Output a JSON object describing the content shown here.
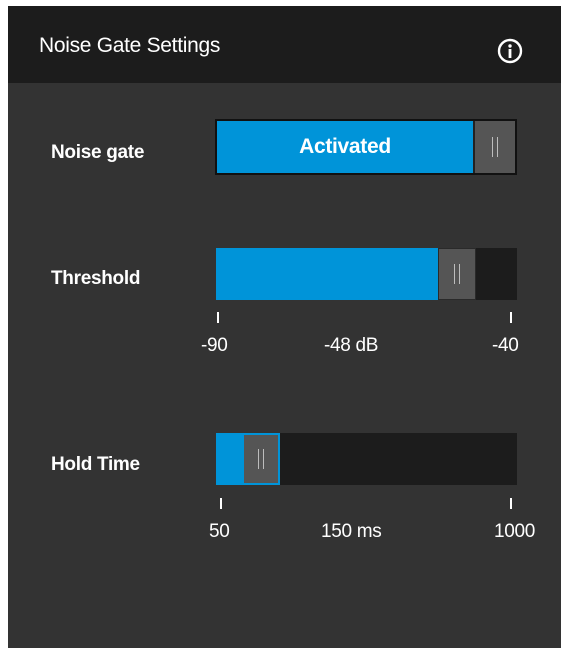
{
  "panel": {
    "title": "Noise Gate Settings",
    "info_icon": "info-icon"
  },
  "noise_gate": {
    "label": "Noise gate",
    "state_label": "Activated",
    "enabled": true
  },
  "threshold": {
    "label": "Threshold",
    "min_label": "-90",
    "value_label": "-48 dB",
    "max_label": "-40",
    "min": -90,
    "max": -40,
    "value": -48
  },
  "hold_time": {
    "label": "Hold Time",
    "min_label": "50",
    "value_label": "150 ms",
    "max_label": "1000",
    "min": 50,
    "max": 1000,
    "value": 150
  },
  "colors": {
    "accent": "#0094d9",
    "panel_bg": "#333333",
    "header_bg": "#1c1c1c",
    "track_bg": "#1c1c1c",
    "handle": "#555555",
    "text": "#ffffff"
  }
}
